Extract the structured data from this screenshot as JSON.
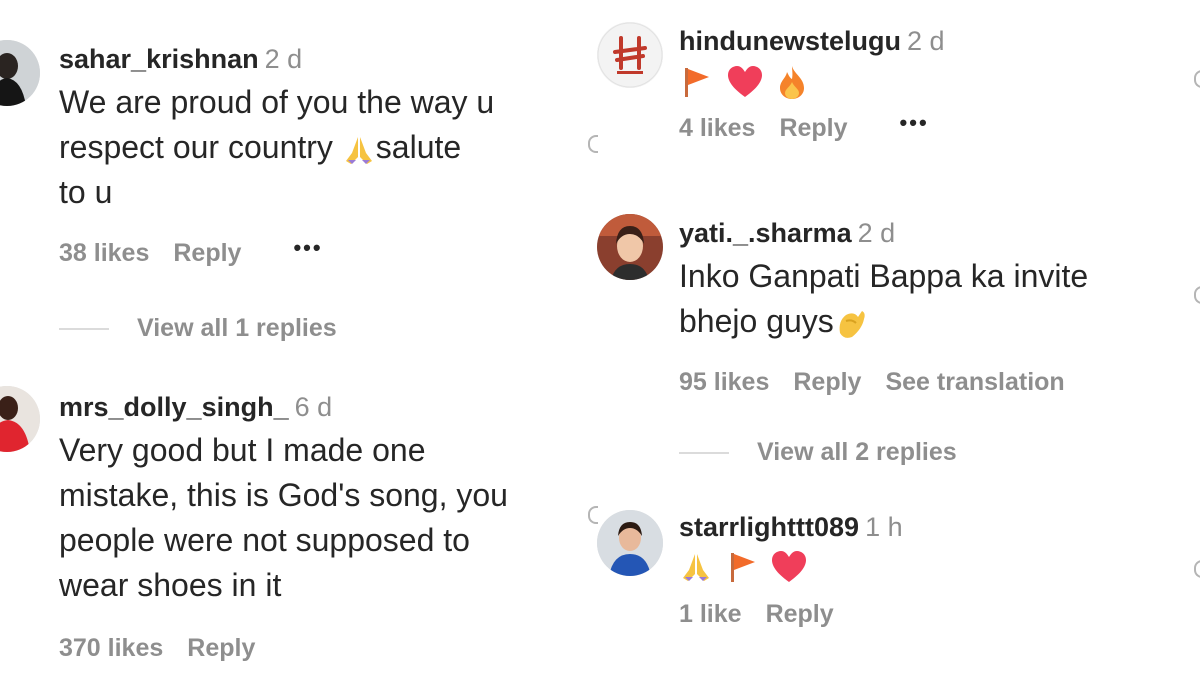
{
  "comments": [
    {
      "username": "sahar_krishnan",
      "time": "2 d",
      "text_lines": [
        "We are proud of you the way u",
        "respect our country ",
        "salute",
        "to u"
      ],
      "emoji": [
        "folded-hands"
      ],
      "likes": "38 likes",
      "reply": "Reply",
      "more": "•••",
      "view_replies": "View all 1 replies"
    },
    {
      "username": "mrs_dolly_singh_",
      "time": "6 d",
      "text_lines": [
        "Very good but I made one",
        "mistake, this is God's song, you",
        "people were not supposed to",
        "wear shoes in it"
      ],
      "likes": "370 likes",
      "reply": "Reply"
    },
    {
      "username": "hindunewstelugu",
      "time": "2 d",
      "emoji": [
        "flag",
        "red-heart",
        "fire"
      ],
      "likes": "4 likes",
      "reply": "Reply",
      "more": "•••"
    },
    {
      "username": "yati._.sharma",
      "time": "2 d",
      "text_lines": [
        "Inko Ganpati Bappa ka invite",
        "bhejo guys"
      ],
      "emoji": [
        "pinched-fingers"
      ],
      "likes": "95 likes",
      "reply": "Reply",
      "see_translation": "See translation",
      "view_replies": "View all 2 replies"
    },
    {
      "username": "starrlighttt089",
      "time": "1 h",
      "emoji": [
        "folded-hands",
        "flag",
        "red-heart"
      ],
      "likes": "1 like",
      "reply": "Reply"
    }
  ],
  "colors": {
    "text": "#262626",
    "secondary": "#8e8e8e",
    "divider": "#dbdbdb",
    "heart": "#f03e5a",
    "flag": "#f26b2a"
  }
}
